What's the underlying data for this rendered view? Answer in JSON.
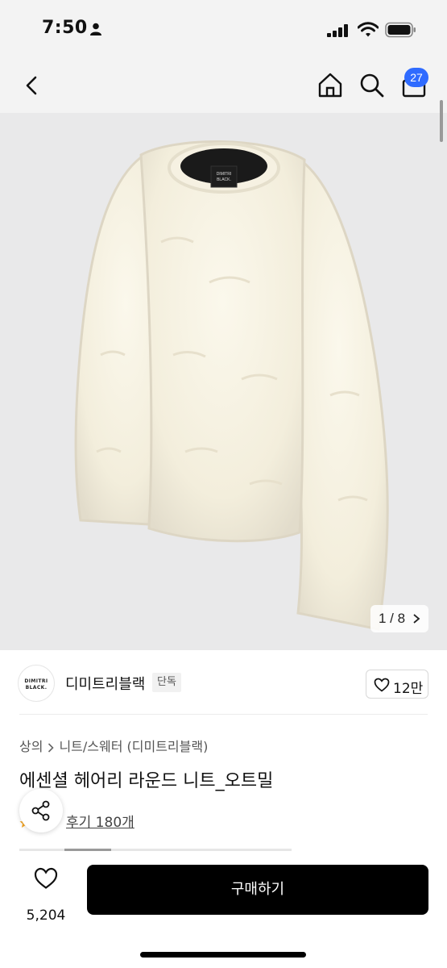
{
  "status_bar": {
    "time": "7:50",
    "icons": [
      "person-icon",
      "cellular-signal-icon",
      "wifi-icon",
      "battery-icon"
    ]
  },
  "header": {
    "icons": [
      "back-arrow-icon",
      "home-icon",
      "search-icon",
      "cart-icon"
    ],
    "cart_count": "27"
  },
  "gallery": {
    "counter": "1 / 8",
    "logo_label_1": "DIMITRI",
    "logo_label_2": "BLACK.",
    "colors": {
      "background": "#e9e9ea",
      "garment": "#f4efdf"
    }
  },
  "brand": {
    "logo_line1": "DIMITRI",
    "logo_line2": "BLACK.",
    "name": "디미트리블랙",
    "badge": "단독",
    "like_count": "12만"
  },
  "product": {
    "breadcrumb": [
      "상의",
      "니트/스웨터 (디미트리블랙)"
    ],
    "title": "에센셜 헤어리 라운드 니트_오트밀",
    "review_link": "후기 180개"
  },
  "bottom_bar": {
    "like_count": "5,204",
    "buy_label": "구매하기",
    "colors": {
      "buy_button": "#000000",
      "badge": "#2f6bff"
    }
  }
}
